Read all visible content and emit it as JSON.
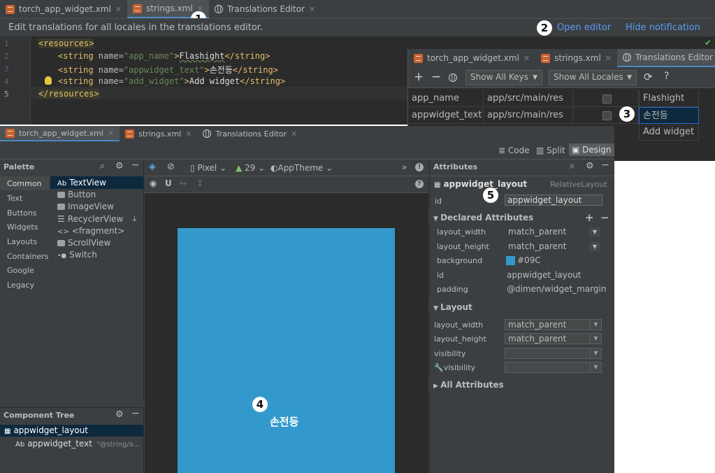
{
  "top_tabs": [
    {
      "label": "torch_app_widget.xml",
      "icon": "xml-file-icon"
    },
    {
      "label": "strings.xml",
      "icon": "xml-file-icon",
      "active": true
    },
    {
      "label": "Translations Editor",
      "icon": "globe-icon"
    }
  ],
  "notification": {
    "message": "Edit translations for all locales in the translations editor.",
    "open_editor": "Open editor",
    "hide": "Hide notification"
  },
  "callouts": [
    "1",
    "2",
    "3",
    "4",
    "5"
  ],
  "code_lines": [
    {
      "num": "1"
    },
    {
      "num": "2"
    },
    {
      "num": "3"
    },
    {
      "num": "4"
    },
    {
      "num": "5"
    }
  ],
  "code": {
    "resources_open": "<resources>",
    "resources_close": "</resources>",
    "string_open": "<string",
    "string_close": "</string>",
    "name_attr": " name=",
    "app_name_key": "\"app_name\"",
    "app_name_val": "Flashight",
    "appwidget_text_key": "\"appwidget_text\"",
    "appwidget_text_val": "손전등",
    "add_widget_key": "\"add_widget\"",
    "add_widget_val": "Add widget",
    "gt": ">"
  },
  "translations_editor": {
    "tabs": [
      {
        "label": "torch_app_widget.xml"
      },
      {
        "label": "strings.xml"
      },
      {
        "label": "Translations Editor",
        "active": true
      }
    ],
    "toolbar": {
      "add": "+",
      "remove": "−",
      "show_keys": "Show All Keys",
      "show_locales": "Show All Locales",
      "help": "?"
    },
    "rows": [
      {
        "key": "app_name",
        "resource": "app/src/main/res",
        "value": "Flashight"
      },
      {
        "key": "appwidget_text",
        "resource": "app/src/main/res",
        "value": "손전등"
      },
      {
        "key": "",
        "resource": "",
        "value": "Add widget"
      }
    ]
  },
  "layout_editor": {
    "tabs": [
      {
        "label": "torch_app_widget.xml",
        "active": true
      },
      {
        "label": "strings.xml"
      },
      {
        "label": "Translations Editor"
      }
    ],
    "modes": {
      "code": "Code",
      "split": "Split",
      "design": "Design"
    },
    "palette": {
      "title": "Palette",
      "categories": [
        "Common",
        "Text",
        "Buttons",
        "Widgets",
        "Layouts",
        "Containers",
        "Google",
        "Legacy"
      ],
      "items": [
        {
          "prefix": "Ab",
          "label": "TextView"
        },
        {
          "label": "Button"
        },
        {
          "label": "ImageView"
        },
        {
          "label": "RecyclerView"
        },
        {
          "prefix": "<>",
          "label": "<fragment>"
        },
        {
          "label": "ScrollView"
        },
        {
          "label": "Switch"
        }
      ]
    },
    "design_toolbar": {
      "device": "Pixel",
      "api": "29",
      "theme": "AppTheme"
    },
    "component_tree": {
      "title": "Component Tree",
      "root": "appwidget_layout",
      "child_prefix": "Ab",
      "child": "appwidget_text",
      "child_value": "\"@string/a..."
    },
    "preview": {
      "text": "손전등",
      "color": "#3399cc"
    },
    "attributes": {
      "title": "Attributes",
      "component": "appwidget_layout",
      "component_type": "RelativeLayout",
      "id_label": "id",
      "id_value": "appwidget_layout",
      "declared_title": "Declared Attributes",
      "declared": [
        {
          "name": "layout_width",
          "value": "match_parent"
        },
        {
          "name": "layout_height",
          "value": "match_parent"
        },
        {
          "name": "background",
          "value": "#09C"
        },
        {
          "name": "id",
          "value": "appwidget_layout"
        },
        {
          "name": "padding",
          "value": "@dimen/widget_margin"
        }
      ],
      "layout_title": "Layout",
      "layout": [
        {
          "name": "layout_width",
          "value": "match_parent"
        },
        {
          "name": "layout_height",
          "value": "match_parent"
        },
        {
          "name": "visibility",
          "value": ""
        },
        {
          "name": "visibility",
          "value": ""
        }
      ],
      "all_title": "All Attributes"
    }
  }
}
